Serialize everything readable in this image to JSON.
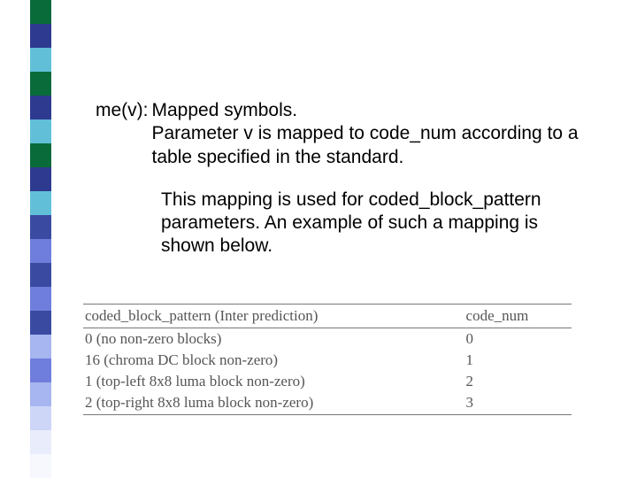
{
  "stripes": [
    "#0a6b3a",
    "#2e3a8f",
    "#61c0d8",
    "#0a6b3a",
    "#2e3a8f",
    "#61c0d8",
    "#0a6b3a",
    "#2e3a8f",
    "#61c0d8",
    "#3a4aa0",
    "#6f7edc",
    "#3a4aa0",
    "#6f7edc",
    "#3a4aa0",
    "#a7b5f0",
    "#6f7edc",
    "#a7b5f0",
    "#ced6f7",
    "#e8ecfb",
    "#f6f8fe"
  ],
  "def": {
    "label": "me(v): ",
    "line1": "Mapped symbols.",
    "body": "Parameter v is mapped to code_num according to a table specified in the standard."
  },
  "para2": "This mapping is used for coded_block_pattern parameters. An example of such a mapping is shown below.",
  "table": {
    "head_left": "coded_block_pattern (Inter prediction)",
    "head_right": "code_num",
    "rows": [
      {
        "left": "0 (no non-zero blocks)",
        "right": "0"
      },
      {
        "left": "16 (chroma DC block non-zero)",
        "right": "1"
      },
      {
        "left": "1 (top-left 8x8 luma block non-zero)",
        "right": "2"
      },
      {
        "left": "2 (top-right 8x8 luma block non-zero)",
        "right": "3"
      }
    ]
  }
}
